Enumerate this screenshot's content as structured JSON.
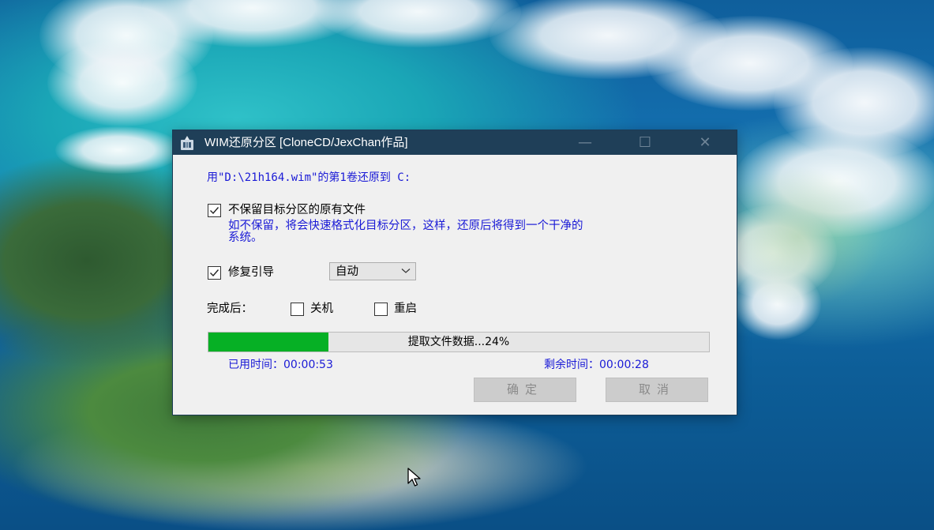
{
  "window": {
    "title": "WIM还原分区  [CloneCD/JexChan作品]",
    "controls": {
      "minimize": "—",
      "maximize": "☐",
      "close": "✕"
    }
  },
  "restore_info": "用\"D:\\21h164.wim\"的第1卷还原到 C:",
  "options": {
    "no_keep_files": {
      "label": "不保留目标分区的原有文件",
      "checked": true,
      "description_line1": "如不保留，将会快速格式化目标分区，这样，还原后将得到一个干净的",
      "description_line2": "系统。"
    },
    "repair_boot": {
      "label": "修复引导",
      "checked": true,
      "mode_selected": "自动"
    }
  },
  "after_complete": {
    "label": "完成后：",
    "shutdown_label": "关机",
    "shutdown_checked": false,
    "restart_label": "重启",
    "restart_checked": false
  },
  "progress": {
    "percent": 24,
    "text": "提取文件数据...24%",
    "elapsed": "已用时间：00:00:53",
    "remaining": "剩余时间：00:00:28"
  },
  "buttons": {
    "ok": "确定",
    "cancel": "取消"
  },
  "colors": {
    "titlebar": "#1f3f58",
    "info_text": "#1a1ad6",
    "progress_fill": "#06b025",
    "dialog_bg": "#f0f0f0"
  }
}
